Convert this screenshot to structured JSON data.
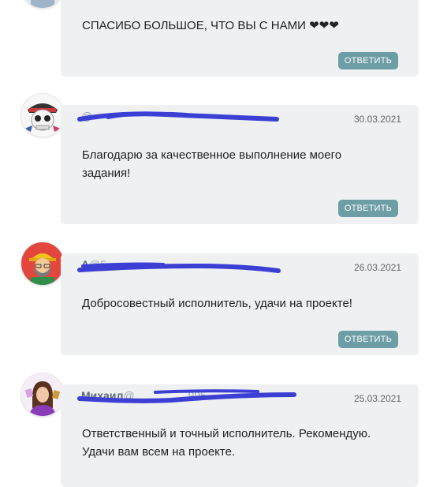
{
  "reply_label": "ОТВЕТИТЬ",
  "comments": [
    {
      "author": "",
      "date": "",
      "text": "СПАСИБО БОЛЬШОЕ, ЧТО ВЫ С НАМИ ❤❤❤"
    },
    {
      "author": "",
      "handle": "@",
      "date": "30.03.2021",
      "text": "Благодарю за качественное выполнение моего задания!"
    },
    {
      "author": "A",
      "handle": "@5",
      "date": "26.03.2021",
      "text": "Добросовестный исполнитель, удачи на проекте!"
    },
    {
      "author": "Михаил",
      "handle": "@",
      "handle_tail": "995",
      "date": "25.03.2021",
      "text_lines": [
        "Ответственный и точный исполнитель. Рекомендую.",
        "Удачи вам всем на проекте."
      ]
    }
  ],
  "colors": {
    "card_bg": "#eef0f2",
    "reply_button": "#6e9ea5",
    "redaction_scribble": "#3b3fd4"
  },
  "icons": [
    "pirate-skull-avatar-icon",
    "builder-avatar-icon",
    "woman-portrait-avatar-icon",
    "user-avatar-icon"
  ]
}
